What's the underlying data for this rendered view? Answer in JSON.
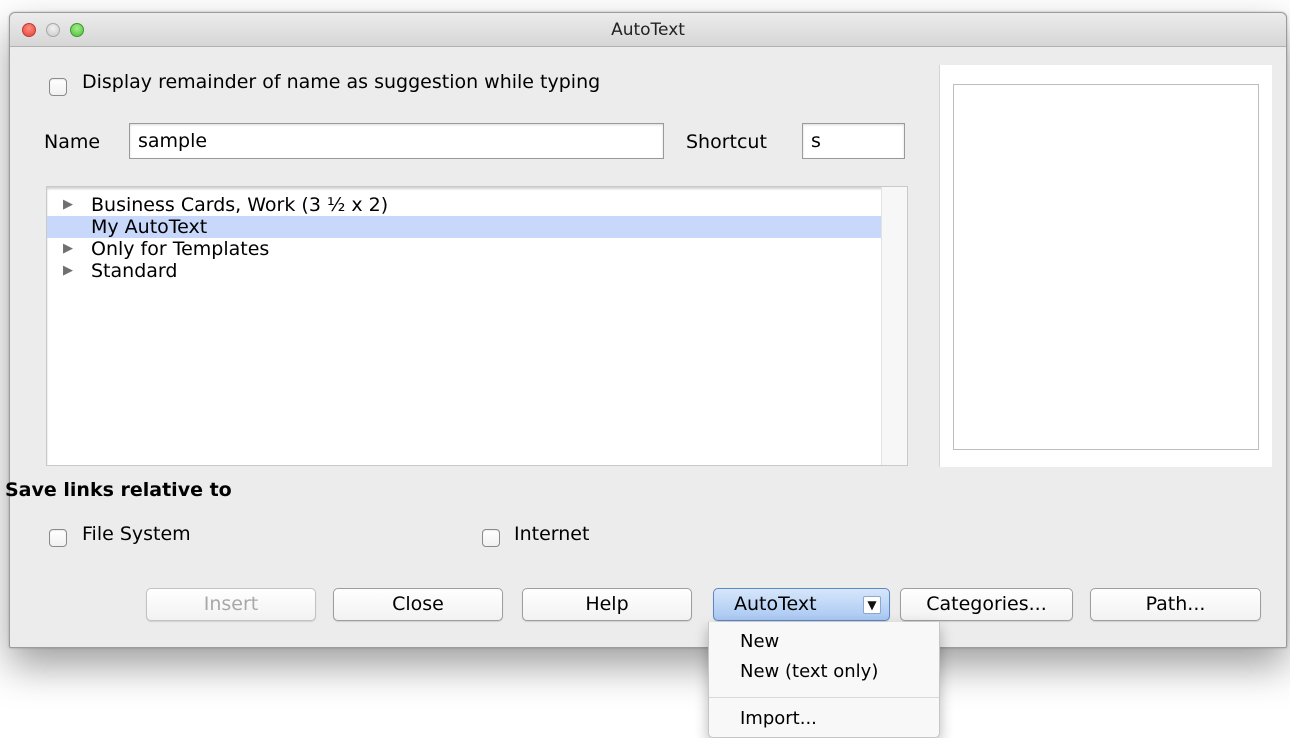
{
  "window": {
    "title": "AutoText"
  },
  "options": {
    "display_remainder_label": "Display remainder of name as suggestion while typing"
  },
  "name_field": {
    "label": "Name",
    "value": "sample"
  },
  "shortcut_field": {
    "label": "Shortcut",
    "value": "s"
  },
  "tree": {
    "items": [
      {
        "label": "Business Cards, Work (3 ½ x 2)",
        "expander": "▶"
      },
      {
        "label": "My AutoText",
        "expander": ""
      },
      {
        "label": "Only for Templates",
        "expander": "▶"
      },
      {
        "label": "Standard",
        "expander": "▶"
      }
    ]
  },
  "save_links": {
    "heading": "Save links relative to",
    "file_system_label": "File System",
    "internet_label": "Internet"
  },
  "buttons": {
    "insert": "Insert",
    "close": "Close",
    "help": "Help",
    "autotext": "AutoText",
    "autotext_arrow": "▼",
    "categories": "Categories...",
    "path": "Path..."
  },
  "menu": {
    "new": "New",
    "new_text_only": "New (text only)",
    "import": "Import..."
  },
  "colors": {
    "selection": "#c8d8fb",
    "active_button": "#a9c8f2",
    "window_bg": "#ececec"
  }
}
